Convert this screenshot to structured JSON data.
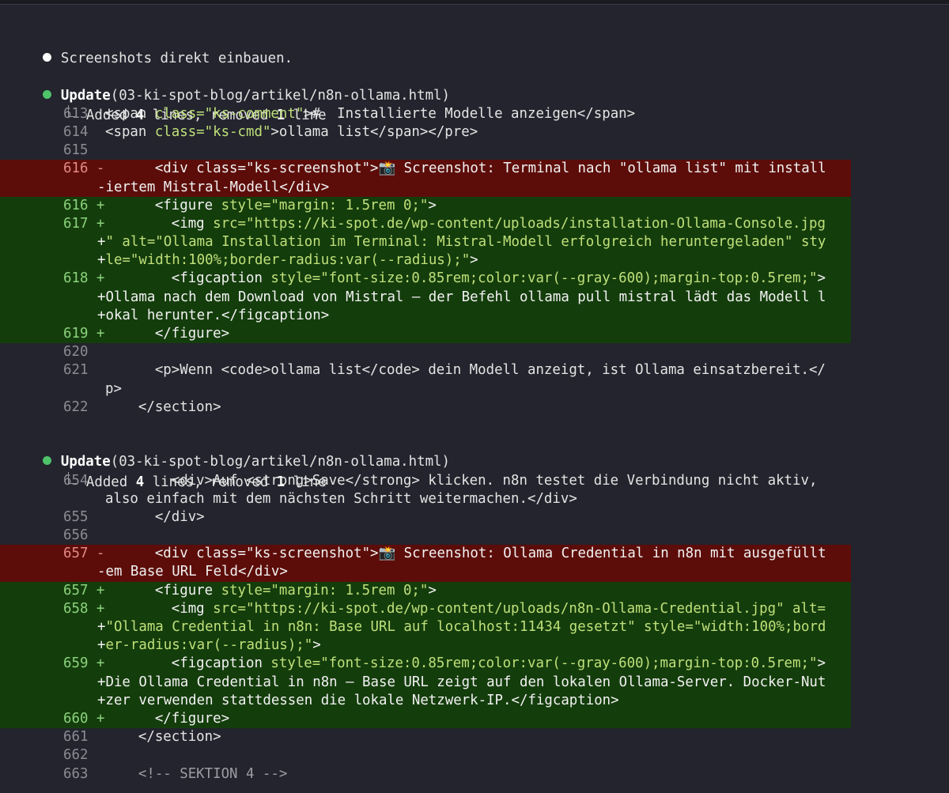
{
  "intro_text": "Screenshots direkt einbauen.",
  "update_label": "Update",
  "update_path": "(03-ki-spot-blog/artikel/n8n-ollama.html)",
  "summary_prefix": "Added",
  "summary_added": "4",
  "summary_mid": "lines, removed",
  "summary_removed": "1",
  "summary_suffix": "line",
  "block1": [
    {
      "num": "613",
      "sign": "",
      "type": "ctx",
      "parts": [
        [
          "<span ",
          ""
        ],
        [
          "class=",
          "attr"
        ],
        [
          "\"ks-comment\"",
          "attr"
        ],
        [
          ">#  Installierte Modelle anzeigen</span>",
          ""
        ]
      ]
    },
    {
      "num": "614",
      "sign": "",
      "type": "ctx",
      "parts": [
        [
          "<span ",
          ""
        ],
        [
          "class=",
          "attr"
        ],
        [
          "\"ks-cmd\"",
          "attr"
        ],
        [
          ">ollama list</span></pre>",
          ""
        ]
      ]
    },
    {
      "num": "615",
      "sign": "",
      "type": "ctx",
      "parts": []
    },
    {
      "num": "616",
      "sign": "-",
      "type": "del",
      "parts": [
        [
          "      <div class=\"ks-screenshot\">📸 Screenshot: Terminal nach \"ollama list\" mit install",
          ""
        ]
      ]
    },
    {
      "num": "",
      "sign": "",
      "type": "del",
      "cont": true,
      "parts": [
        [
          "-iertem Mistral-Modell</div>",
          ""
        ]
      ]
    },
    {
      "num": "616",
      "sign": "+",
      "type": "add",
      "parts": [
        [
          "      <figure ",
          ""
        ],
        [
          "style=",
          "attr"
        ],
        [
          "\"margin: 1.5rem 0;\"",
          "attr"
        ],
        [
          ">",
          ""
        ]
      ]
    },
    {
      "num": "617",
      "sign": "+",
      "type": "add",
      "parts": [
        [
          "        <img ",
          ""
        ],
        [
          "src=",
          "attr"
        ],
        [
          "\"https://ki-spot.de/wp-content/uploads/installation-Ollama-Console.jpg",
          "attr"
        ]
      ]
    },
    {
      "num": "",
      "sign": "",
      "type": "add",
      "cont": true,
      "parts": [
        [
          "+",
          ""
        ],
        [
          "\" alt=\"Ollama Installation im Terminal: Mistral-Modell erfolgreich heruntergeladen\" sty",
          "attr"
        ]
      ]
    },
    {
      "num": "",
      "sign": "",
      "type": "add",
      "cont": true,
      "parts": [
        [
          "+",
          ""
        ],
        [
          "le=\"width:100%;border-radius:var(--radius);\"",
          "attr"
        ],
        [
          ">",
          ""
        ]
      ]
    },
    {
      "num": "618",
      "sign": "+",
      "type": "add",
      "parts": [
        [
          "        <figcaption ",
          ""
        ],
        [
          "style=",
          "attr"
        ],
        [
          "\"font-size:0.85rem;color:var(--gray-600);margin-top:0.5rem;\"",
          "attr"
        ],
        [
          ">",
          ""
        ]
      ]
    },
    {
      "num": "",
      "sign": "",
      "type": "add",
      "cont": true,
      "parts": [
        [
          "+Ollama nach dem Download von Mistral — der Befehl ollama pull mistral lädt das Modell l",
          ""
        ]
      ]
    },
    {
      "num": "",
      "sign": "",
      "type": "add",
      "cont": true,
      "parts": [
        [
          "+okal herunter.</figcaption>",
          ""
        ]
      ]
    },
    {
      "num": "619",
      "sign": "+",
      "type": "add",
      "parts": [
        [
          "      </figure>",
          ""
        ]
      ]
    },
    {
      "num": "620",
      "sign": "",
      "type": "ctx",
      "parts": []
    },
    {
      "num": "621",
      "sign": "",
      "type": "ctx",
      "parts": [
        [
          "      <p>Wenn <code>ollama list</code> dein Modell anzeigt, ist Ollama einsatzbereit.</",
          ""
        ]
      ]
    },
    {
      "num": "",
      "sign": "",
      "type": "ctx",
      "cont2": true,
      "parts": [
        [
          "p>",
          ""
        ]
      ]
    },
    {
      "num": "622",
      "sign": "",
      "type": "ctx",
      "parts": [
        [
          "    </section>",
          ""
        ]
      ]
    }
  ],
  "block2": [
    {
      "num": "654",
      "sign": "",
      "type": "ctx",
      "parts": [
        [
          "        <div>Auf <strong>Save</strong> klicken. n8n testet die Verbindung nicht aktiv,",
          ""
        ]
      ]
    },
    {
      "num": "",
      "sign": "",
      "type": "ctx",
      "cont2": true,
      "parts": [
        [
          "also einfach mit dem nächsten Schritt weitermachen.</div>",
          ""
        ]
      ]
    },
    {
      "num": "655",
      "sign": "",
      "type": "ctx",
      "parts": [
        [
          "      </div>",
          ""
        ]
      ]
    },
    {
      "num": "656",
      "sign": "",
      "type": "ctx",
      "parts": []
    },
    {
      "num": "657",
      "sign": "-",
      "type": "del",
      "parts": [
        [
          "      <div class=\"ks-screenshot\">📸 Screenshot: Ollama Credential in n8n mit ausgefüllt",
          ""
        ]
      ]
    },
    {
      "num": "",
      "sign": "",
      "type": "del",
      "cont": true,
      "parts": [
        [
          "-em Base URL Feld</div>",
          ""
        ]
      ]
    },
    {
      "num": "657",
      "sign": "+",
      "type": "add",
      "parts": [
        [
          "      <figure ",
          ""
        ],
        [
          "style=",
          "attr"
        ],
        [
          "\"margin: 1.5rem 0;\"",
          "attr"
        ],
        [
          ">",
          ""
        ]
      ]
    },
    {
      "num": "658",
      "sign": "+",
      "type": "add",
      "parts": [
        [
          "        <img ",
          ""
        ],
        [
          "src=",
          "attr"
        ],
        [
          "\"https://ki-spot.de/wp-content/uploads/n8n-Ollama-Credential.jpg\" alt=",
          "attr"
        ]
      ]
    },
    {
      "num": "",
      "sign": "",
      "type": "add",
      "cont": true,
      "parts": [
        [
          "+",
          ""
        ],
        [
          "\"Ollama Credential in n8n: Base URL auf localhost:11434 gesetzt\" style=\"width:100%;bord",
          "attr"
        ]
      ]
    },
    {
      "num": "",
      "sign": "",
      "type": "add",
      "cont": true,
      "parts": [
        [
          "+",
          ""
        ],
        [
          "er-radius:var(--radius);\"",
          "attr"
        ],
        [
          ">",
          ""
        ]
      ]
    },
    {
      "num": "659",
      "sign": "+",
      "type": "add",
      "parts": [
        [
          "        <figcaption ",
          ""
        ],
        [
          "style=",
          "attr"
        ],
        [
          "\"font-size:0.85rem;color:var(--gray-600);margin-top:0.5rem;\"",
          "attr"
        ],
        [
          ">",
          ""
        ]
      ]
    },
    {
      "num": "",
      "sign": "",
      "type": "add",
      "cont": true,
      "parts": [
        [
          "+Die Ollama Credential in n8n — Base URL zeigt auf den lokalen Ollama-Server. Docker-Nut",
          ""
        ]
      ]
    },
    {
      "num": "",
      "sign": "",
      "type": "add",
      "cont": true,
      "parts": [
        [
          "+zer verwenden stattdessen die lokale Netzwerk-IP.</figcaption>",
          ""
        ]
      ]
    },
    {
      "num": "660",
      "sign": "+",
      "type": "add",
      "parts": [
        [
          "      </figure>",
          ""
        ]
      ]
    },
    {
      "num": "661",
      "sign": "",
      "type": "ctx",
      "parts": [
        [
          "    </section>",
          ""
        ]
      ]
    },
    {
      "num": "662",
      "sign": "",
      "type": "ctx",
      "parts": []
    },
    {
      "num": "663",
      "sign": "",
      "type": "ctx",
      "parts": [
        [
          "    <!-- SEKTION 4 -->",
          "muted"
        ]
      ]
    }
  ]
}
